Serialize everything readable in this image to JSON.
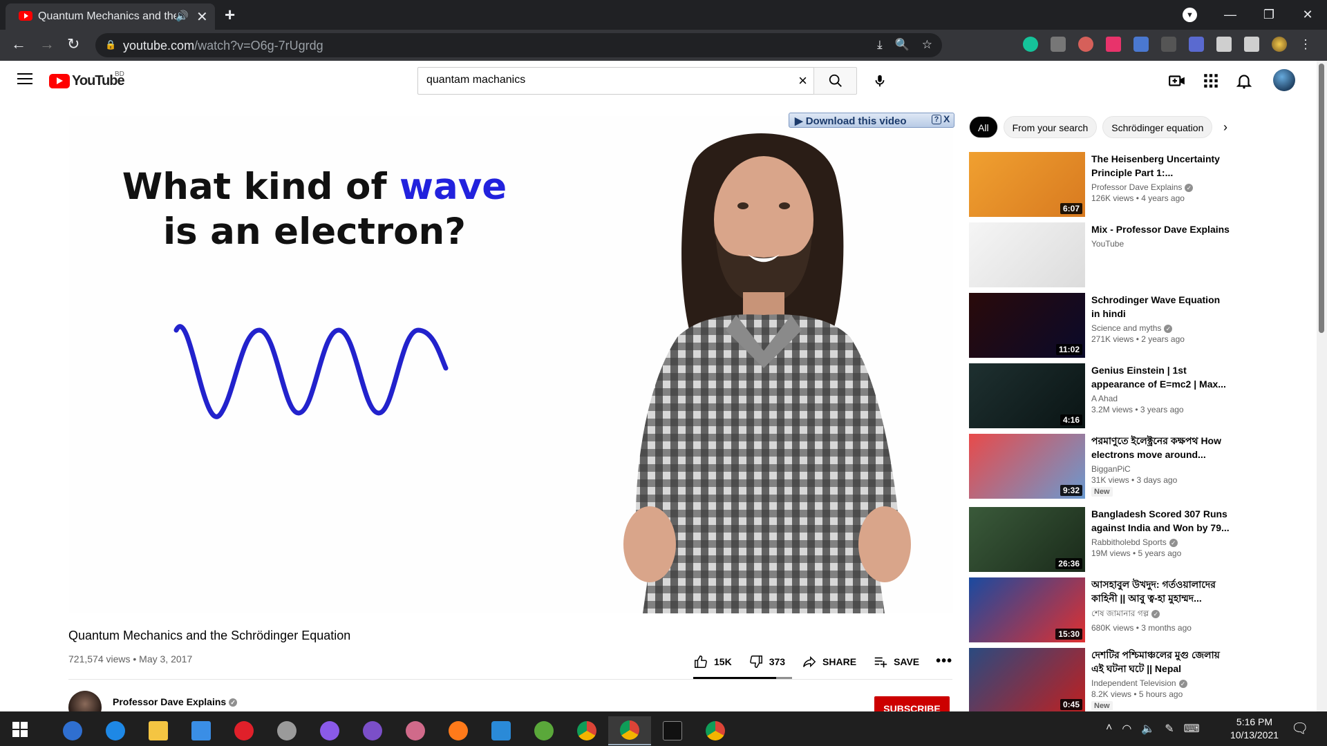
{
  "browser": {
    "tab_title": "Quantum Mechanics and the Schrödinger Equation - YouTube",
    "url_host": "youtube.com",
    "url_path": "/watch?v=O6g-7rUgrdg"
  },
  "youtube": {
    "logo_text": "YouTube",
    "region": "BD",
    "search_value": "quantam machanics"
  },
  "player": {
    "slide_line1": "What kind of ",
    "slide_highlight": "wave",
    "slide_line2": "is an electron?",
    "download_banner": "▶ Download this video",
    "download_help": "?",
    "download_close": "X"
  },
  "video": {
    "title": "Quantum Mechanics and the Schrödinger Equation",
    "meta": "721,574 views • May 3, 2017",
    "likes": "15K",
    "dislikes": "373",
    "share": "SHARE",
    "save": "SAVE",
    "like_ratio": 0.84,
    "channel": "Professor Dave Explains",
    "subscribe": "SUBSCRIBE"
  },
  "chips": [
    "All",
    "From your search",
    "Schrödinger equation"
  ],
  "recommendations": [
    {
      "title": "The Heisenberg Uncertainty Principle Part 1:...",
      "channel": "Professor Dave Explains",
      "verified": true,
      "stats": "126K views • 4 years ago",
      "duration": "6:07",
      "color1": "#f0a030",
      "color2": "#d87a20"
    },
    {
      "title": "Mix - Professor Dave Explains",
      "channel": "YouTube",
      "verified": false,
      "stats": "",
      "duration": "",
      "color1": "#f5f5f5",
      "color2": "#dcdcdc"
    },
    {
      "title": "Schrodinger Wave Equation in hindi",
      "channel": "Science and myths",
      "verified": true,
      "stats": "271K views • 2 years ago",
      "duration": "11:02",
      "color1": "#2a0a0a",
      "color2": "#0a0a2a"
    },
    {
      "title": "Genius Einstein | 1st appearance of E=mc2 | Max...",
      "channel": "A Ahad",
      "verified": false,
      "stats": "3.2M views • 3 years ago",
      "duration": "4:16",
      "color1": "#1e3030",
      "color2": "#0a1414"
    },
    {
      "title": "পরমাণুতে ইলেক্ট্রনের কক্ষপথ How electrons move around...",
      "channel": "BigganPiC",
      "verified": false,
      "stats": "31K views • 3 days ago",
      "duration": "9:32",
      "badge": "New",
      "color1": "#e84a4a",
      "color2": "#6a9ad0"
    },
    {
      "title": "Bangladesh Scored 307 Runs against India and Won by 79...",
      "channel": "Rabbitholebd Sports",
      "verified": true,
      "stats": "19M views • 5 years ago",
      "duration": "26:36",
      "color1": "#3a5a3a",
      "color2": "#1a2a1a"
    },
    {
      "title": "আসহাবুল উখদুদ: গর্তওয়ালাদের কাহিনী || আবু ত্ব-হা মুহাম্মদ...",
      "channel": "শেষ জামানার গল্প",
      "verified": true,
      "stats": "680K views • 3 months ago",
      "duration": "15:30",
      "color1": "#1a4aa0",
      "color2": "#e03030"
    },
    {
      "title": "দেশটির পশ্চিমাঞ্চলের মুগু জেলায় এই ঘটনা ঘটে || Nepal",
      "channel": "Independent Television",
      "verified": true,
      "stats": "8.2K views • 5 hours ago",
      "duration": "0:45",
      "badge": "New",
      "color1": "#2a4a80",
      "color2": "#c02020"
    }
  ],
  "taskbar": {
    "time": "5:16 PM",
    "date": "10/13/2021"
  }
}
